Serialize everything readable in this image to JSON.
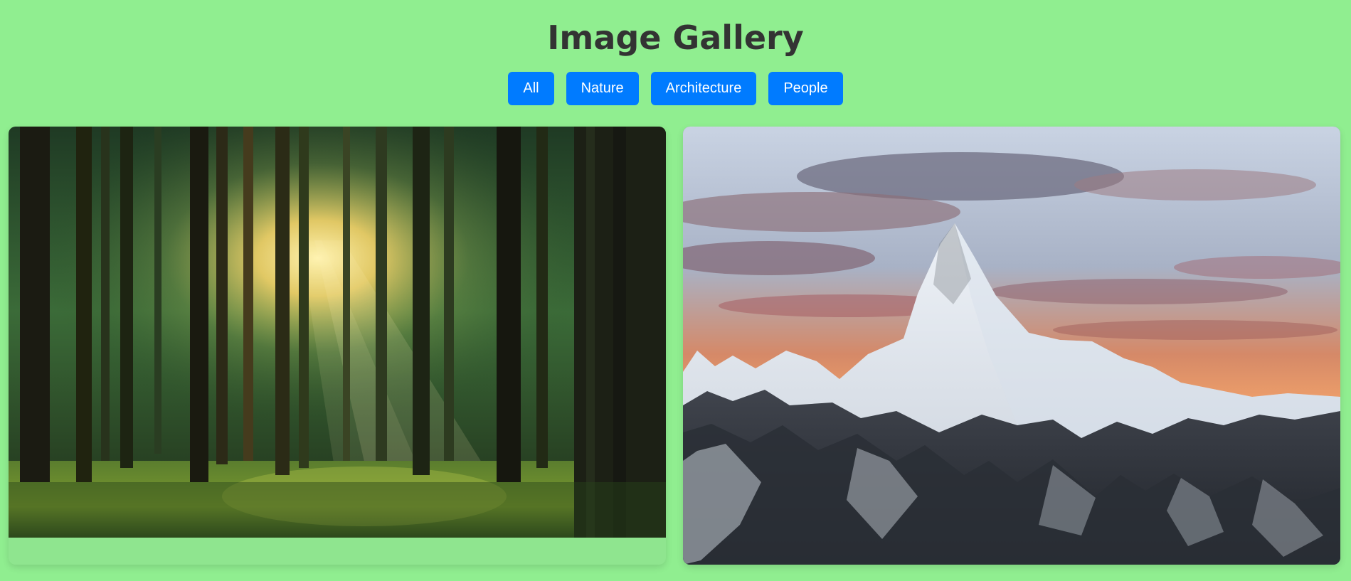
{
  "page": {
    "title": "Image Gallery"
  },
  "filters": [
    {
      "label": "All"
    },
    {
      "label": "Nature"
    },
    {
      "label": "Architecture"
    },
    {
      "label": "People"
    }
  ],
  "gallery": {
    "items": [
      {
        "subject": "forest-sunrise"
      },
      {
        "subject": "snowy-mountain-sunset"
      }
    ]
  },
  "colors": {
    "background": "#90ee90",
    "button": "#007bff",
    "button_text": "#ffffff",
    "title": "#333333"
  }
}
